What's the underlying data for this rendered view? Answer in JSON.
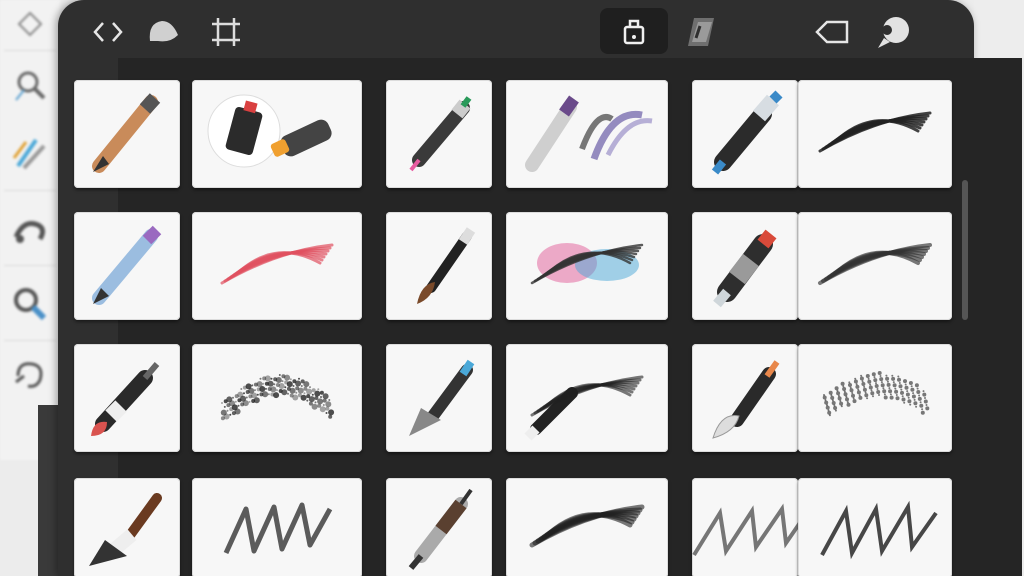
{
  "toolbar": {
    "items": [
      {
        "id": "code-icon"
      },
      {
        "id": "leaf-icon"
      },
      {
        "id": "swap-icon"
      },
      {
        "id": "brush-library-icon",
        "active": true
      },
      {
        "id": "layers-icon"
      },
      {
        "id": "tag-icon"
      },
      {
        "id": "chat-icon"
      }
    ]
  },
  "left_rail": {
    "icons": [
      "transform-icon",
      "magnifier-icon",
      "brushes-icon",
      "smudge-icon",
      "zoom-icon",
      "lasso-icon"
    ]
  },
  "brush_library": {
    "rows": [
      [
        "pencil-icon",
        "marker-pair-icon",
        "fineliner-icon",
        "pen-stroke-icon",
        "highlighter-icon",
        "charcoal-stroke-icon"
      ],
      [
        "blue-pencil-icon",
        "red-chalk-stroke-icon",
        "ink-brush-icon",
        "watercolor-stroke-icon",
        "paint-tube-icon",
        "dry-brush-stroke-icon"
      ],
      [
        "crayon-icon",
        "spray-stroke-icon",
        "fan-brush-icon",
        "round-brush-stroke-icon",
        "flat-brush-icon",
        "texture-stroke-icon"
      ],
      [
        "wide-brush-icon",
        "scribble-stroke-icon",
        "detail-brush-icon",
        "smear-stroke-icon",
        "hatch-stroke-icon",
        "grass-stroke-icon"
      ]
    ]
  },
  "colors": {
    "panel": "#2f2f2f",
    "card": "#f7f7f7",
    "pink": "#e46aa0",
    "purple": "#7a6fb0",
    "red": "#d9534f",
    "blue": "#4aa8d8"
  }
}
